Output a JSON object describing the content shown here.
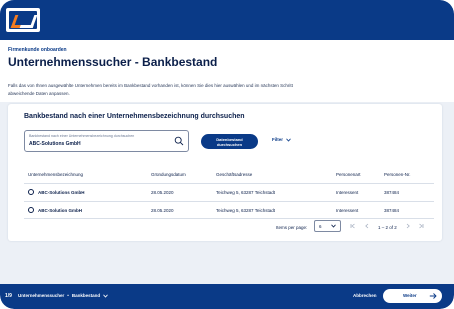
{
  "header": {
    "eyebrow": "Firmenkunde onboarden",
    "title": "Unternehmenssucher - Bankbestand",
    "intro": "Falls das von Ihnen ausgewählte Unternehmen bereits im Bankbestand vorhanden ist, können Sie dies hier auswählen und im nächsten Schritt abweichende Daten anpassen."
  },
  "card": {
    "title": "Bankbestand nach einer Unternehmensbezeichnung durchsuchen",
    "search": {
      "placeholder": "Bankbestand nach einer Unternehmensbezeichnung durchsuchen",
      "value": "ABC-Solutions GmbH"
    },
    "search_button_line1": "Datenbestand",
    "search_button_line2": "durchsuchen",
    "filter_label": "Filter"
  },
  "table": {
    "columns": [
      "Unternehmensbezeichnung",
      "Gründungsdatum",
      "Geschäftsadresse",
      "Personenart",
      "Personen-Nr."
    ],
    "rows": [
      [
        "ABC-Solutions GmbH",
        "28.05.2020",
        "Teichweg 5, 63287 Teichstadt",
        "Interessent",
        "387484"
      ],
      [
        "ABC-Solution GmbH",
        "28.05.2020",
        "Teichweg 5, 63287 Teichstadt",
        "Interessent",
        "387484"
      ]
    ]
  },
  "pager": {
    "items_label": "Items per page:",
    "items_value": "6",
    "range": "1 – 2 of 2"
  },
  "footer": {
    "step": "1/9",
    "breadcrumb_a": "Unternehmenssucher",
    "breadcrumb_sep": "•",
    "breadcrumb_b": "Bankbestand",
    "cancel": "Abbrechen",
    "next": "Weiter"
  },
  "colors": {
    "brand": "#0a3a87",
    "accent": "#f47b20"
  }
}
